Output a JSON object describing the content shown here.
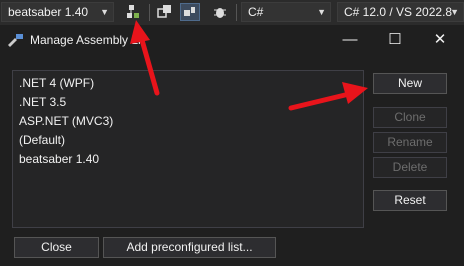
{
  "toolbar": {
    "assembly_list": "beatsaber 1.40",
    "language": "C#",
    "language_version": "C# 12.0 / VS 2022.8"
  },
  "dialog": {
    "title": "Manage Assembly Li",
    "minimize_glyph": "—",
    "maximize_glyph": "☐",
    "close_glyph": "✕",
    "list_items": [
      ".NET 4 (WPF)",
      ".NET 3.5",
      "ASP.NET (MVC3)",
      "(Default)",
      "beatsaber 1.40"
    ],
    "buttons": {
      "new": "New",
      "clone": "Clone",
      "rename": "Rename",
      "delete": "Delete",
      "reset": "Reset",
      "close": "Close",
      "add_preconfigured": "Add preconfigured list..."
    }
  },
  "colors": {
    "arrow": "#e8141b",
    "disabled_text": "#6d6d6d"
  },
  "icons": [
    "manage-assembly-lists-icon",
    "references-icon",
    "pin-icon",
    "debug-icon",
    "dialog-app-icon"
  ]
}
